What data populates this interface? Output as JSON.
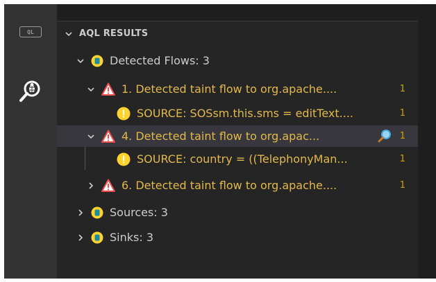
{
  "activity_bar": {
    "ql_badge": "QL",
    "items": [
      {
        "icon": "ql-badge-icon"
      },
      {
        "icon": "search-bug-icon"
      }
    ]
  },
  "panel": {
    "section_title": "AQL RESULTS",
    "tree": {
      "detected_flows": {
        "label": "Detected Flows: 3",
        "flows": [
          {
            "label": "1. Detected taint flow to org.apache....",
            "count": "1",
            "source": {
              "label": "SOURCE: SOSsm.this.sms = editText....",
              "count": "1"
            }
          },
          {
            "label": "4. Detected taint flow to org.apac...",
            "count": "1",
            "selected": true,
            "source": {
              "label": "SOURCE: country = ((TelephonyMan...",
              "count": "1"
            }
          },
          {
            "label": "6. Detected taint flow to org.apache....",
            "count": "1"
          }
        ]
      },
      "sources": {
        "label": "Sources: 3"
      },
      "sinks": {
        "label": "Sinks: 3"
      }
    }
  },
  "colors": {
    "accent_gold": "#e2b94a",
    "warning_red": "#f14c4c",
    "db_yellow": "#ffd22e",
    "db_teal": "#1a8da0",
    "selection_bg": "#37373d"
  }
}
